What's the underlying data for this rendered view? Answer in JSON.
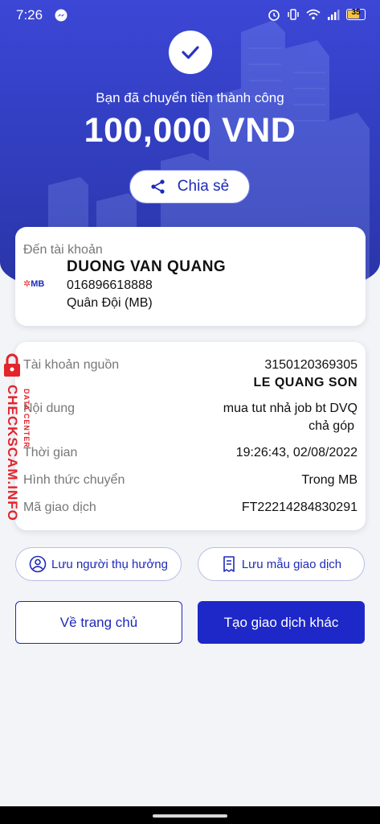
{
  "status_bar": {
    "time": "7:26",
    "battery": "35"
  },
  "hero": {
    "subtitle": "Bạn đã chuyển tiền thành công",
    "amount": "100,000 VND",
    "share_label": "Chia sẻ"
  },
  "recipient": {
    "label": "Đến tài khoản",
    "bank_logo": "MB",
    "name": "DUONG VAN QUANG",
    "account": "016896618888",
    "bank": "Quân Đội (MB)"
  },
  "details": {
    "source_label": "Tài khoản nguồn",
    "source_account": "3150120369305",
    "source_name": "LE QUANG SON",
    "content_label": "Nội dung",
    "content_line1": "mua tut nhả job bt DVQ",
    "content_line2": "chả góp",
    "time_label": "Thời gian",
    "time_value": "19:26:43, 02/08/2022",
    "method_label": "Hình thức chuyển",
    "method_value": "Trong MB",
    "txn_label": "Mã giao dịch",
    "txn_value": "FT22214284830291"
  },
  "actions": {
    "save_beneficiary": "Lưu người thụ hưởng",
    "save_template": "Lưu mẫu giao dịch",
    "home": "Về trang chủ",
    "new_transaction": "Tạo giao dịch khác"
  },
  "watermark": {
    "main": "CHECKSCAM.INFO",
    "sub": "DATA CENTER"
  },
  "colors": {
    "primary": "#1e28c8",
    "hero": "#3340c4",
    "watermark": "#e3242b"
  }
}
